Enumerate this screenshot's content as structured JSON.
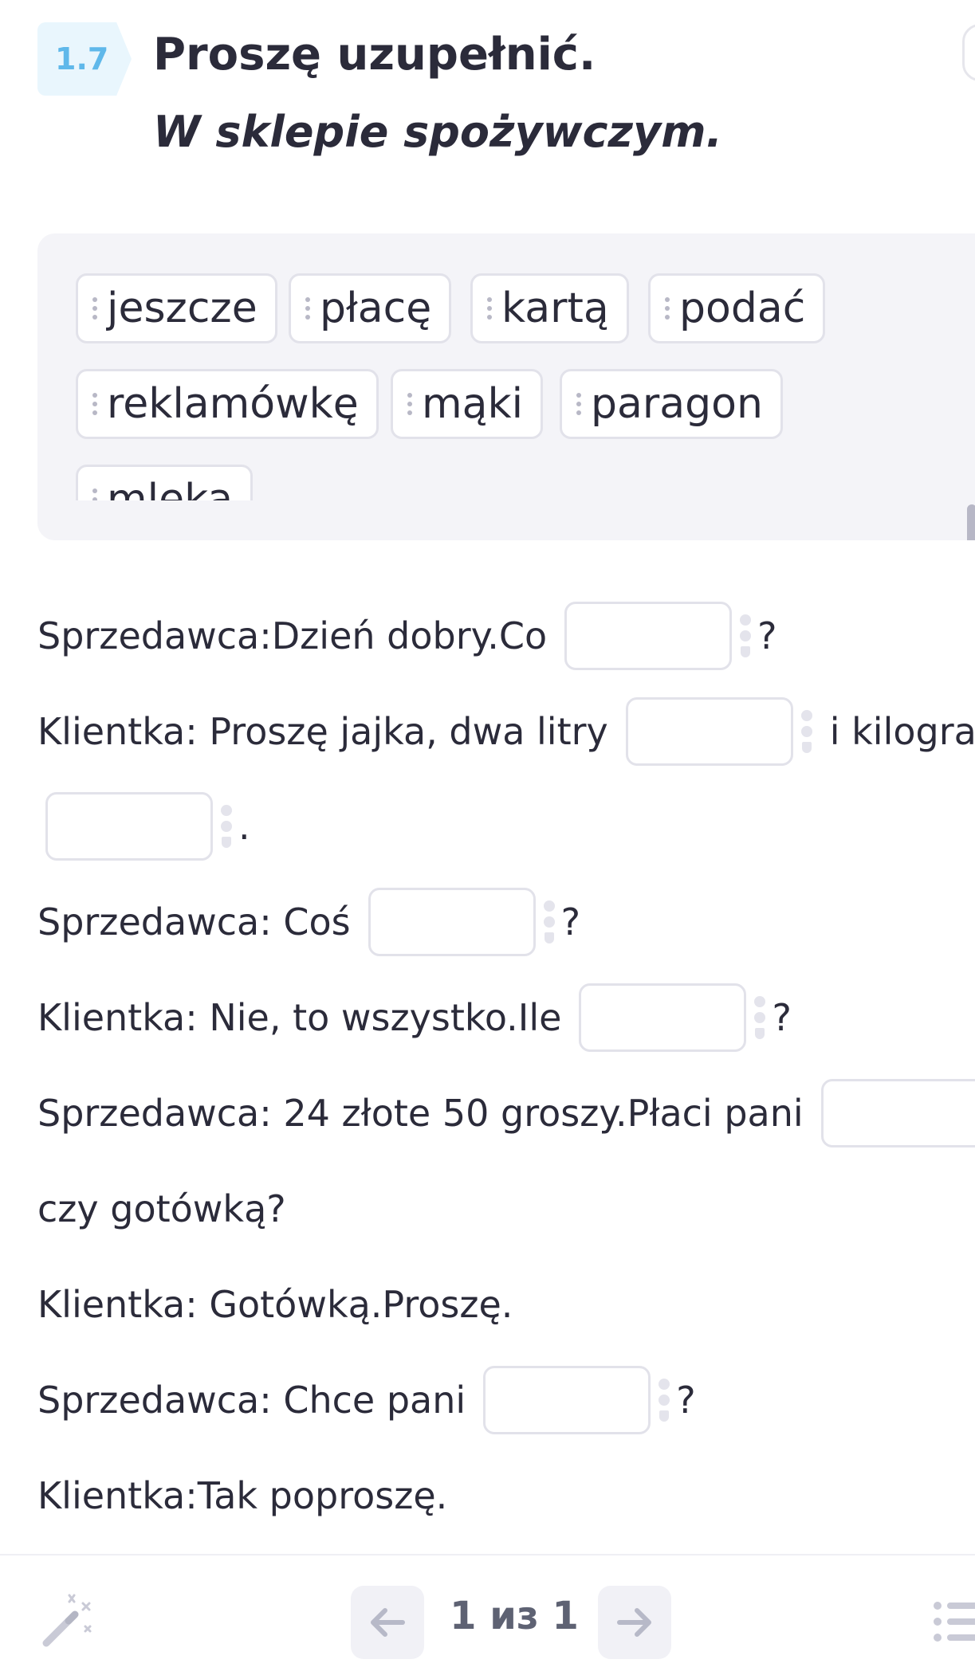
{
  "header": {
    "badge": "1.7",
    "title": "Proszę uzupełnić.",
    "subtitle": "W sklepie spożywczym."
  },
  "word_bank": {
    "chips": [
      "jeszcze",
      "płacę",
      "kartą",
      "podać",
      "reklamówkę",
      "mąki",
      "paragon",
      "mleka"
    ]
  },
  "dialogue": {
    "l1_before": "Sprzedawca:Dzień dobry.Co",
    "l1_after": "?",
    "l2_before": "Klientka: Proszę jajka, dwa litry",
    "l2_after": "i kilogram",
    "l3_after": ".",
    "l4_before": "Sprzedawca: Coś",
    "l4_after": "?",
    "l5_before": "Klientka: Nie, to wszystko.Ile",
    "l5_after": "?",
    "l6_before": "Sprzedawca: 24 złote 50 groszy.Płaci pani",
    "l7_text": "czy gotówką?",
    "l8_text": "Klientka: Gotówką.Proszę.",
    "l9_before": "Sprzedawca: Chce pani",
    "l9_after": "?",
    "l10_text": "Klientka:Tak poproszę."
  },
  "footer": {
    "pager": "1 из 1",
    "icons": {
      "left": "magic-wand-icon",
      "prev": "arrow-left-icon",
      "next": "arrow-right-icon",
      "right": "list-icon"
    }
  },
  "colors": {
    "accent": "#5fb8ea",
    "badge_bg": "#e9f6fd",
    "bank_bg": "#f4f4f8",
    "border": "#e2e2ea",
    "text": "#2b2b3a"
  }
}
